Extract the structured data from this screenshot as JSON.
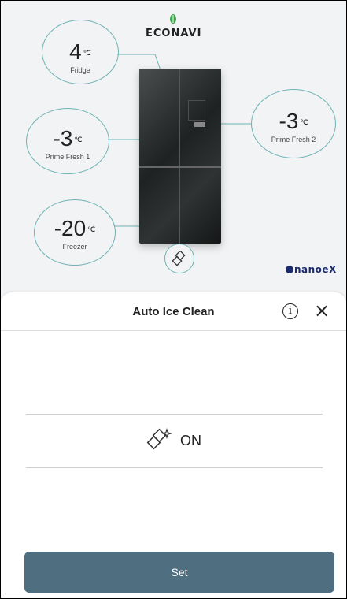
{
  "brand": {
    "econavi": "ECONAVI",
    "nanoe": "nanoe",
    "nanoe_x": "X"
  },
  "compartments": {
    "fridge": {
      "value": "4",
      "unit": "℃",
      "label": "Fridge"
    },
    "prime_fresh_1": {
      "value": "-3",
      "unit": "℃",
      "label": "Prime Fresh 1"
    },
    "prime_fresh_2": {
      "value": "-3",
      "unit": "℃",
      "label": "Prime Fresh 2"
    },
    "freezer": {
      "value": "-20",
      "unit": "℃",
      "label": "Freezer"
    }
  },
  "sheet": {
    "title": "Auto Ice Clean",
    "info_icon": "info-icon",
    "close_icon": "close-icon",
    "picker_value": "ON",
    "set_label": "Set"
  },
  "colors": {
    "accent": "#4f6f80",
    "bubble_border": "#6fb3b5",
    "brand_blue": "#1b2a6b",
    "leaf_green": "#3aa64a"
  }
}
